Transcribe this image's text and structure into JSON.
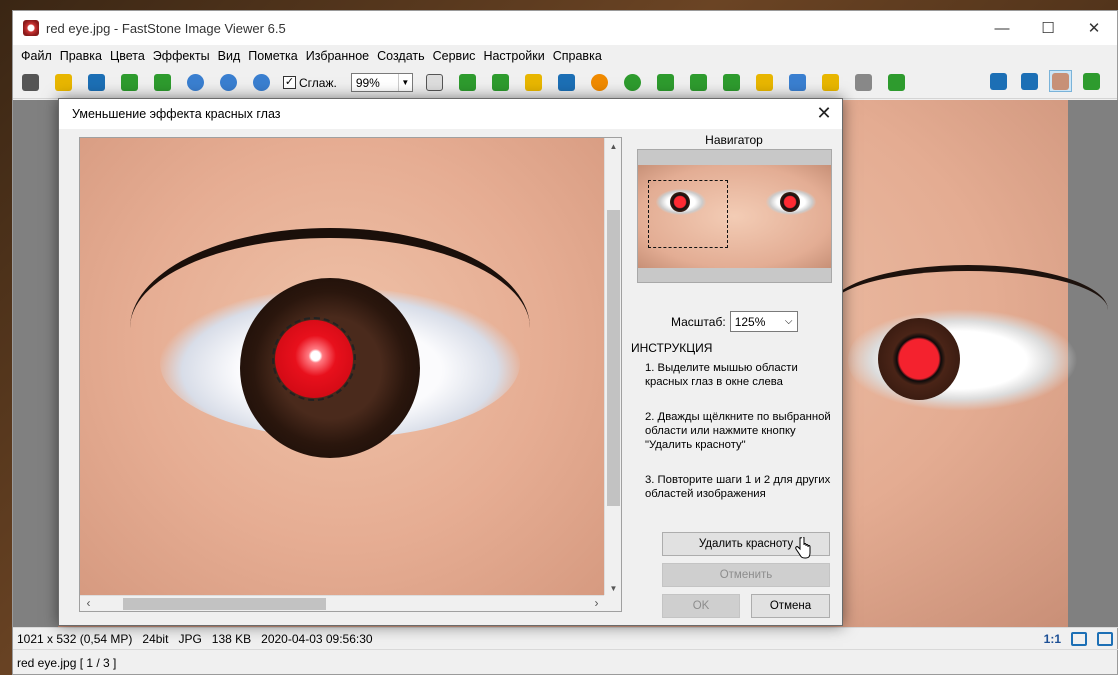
{
  "window": {
    "title": "red eye.jpg  -  FastStone Image Viewer 6.5",
    "minimize": "—",
    "maximize": "☐",
    "close": "✕"
  },
  "menu": [
    "Файл",
    "Правка",
    "Цвета",
    "Эффекты",
    "Вид",
    "Пометка",
    "Избранное",
    "Создать",
    "Сервис",
    "Настройки",
    "Справка"
  ],
  "toolbar": {
    "smooth_label": "Сглаж.",
    "smooth_checked": "✓",
    "zoom_value": "99%",
    "zoom_arrow": "▼",
    "colors": {
      "accent_blue": "#1c6fb5",
      "accent_green": "#2e9b2e",
      "accent_yellow": "#e8b600",
      "accent_orange": "#f08a00"
    }
  },
  "dialog": {
    "title": "Уменьшение эффекта красных глаз",
    "close": "✕",
    "navigator_label": "Навигатор",
    "scale_label": "Масштаб:",
    "scale_value": "125%",
    "scale_arrow": "⌵",
    "instructions_title": "ИНСТРУКЦИЯ",
    "step1": "1. Выделите мышью области красных глаз в окне слева",
    "step2": "2. Дважды щёлкните по выбранной области или нажмите кнопку \"Удалить красноту\"",
    "step3": "3. Повторите шаги 1 и 2 для других областей изображения",
    "remove_button": "Удалить красноту",
    "undo_button": "Отменить",
    "ok_button": "OK",
    "cancel_button": "Отмена",
    "scroll_up": "▲",
    "scroll_down": "▼",
    "scroll_left": "‹",
    "scroll_right": "›"
  },
  "status": {
    "dimensions": "1021 x 532 (0,54 MP)",
    "bitdepth": "24bit",
    "format": "JPG",
    "filesize": "138 KB",
    "datetime": "2020-04-03 09:56:30",
    "ratio": "1:1",
    "filename": "red eye.jpg [ 1 / 3 ]"
  }
}
